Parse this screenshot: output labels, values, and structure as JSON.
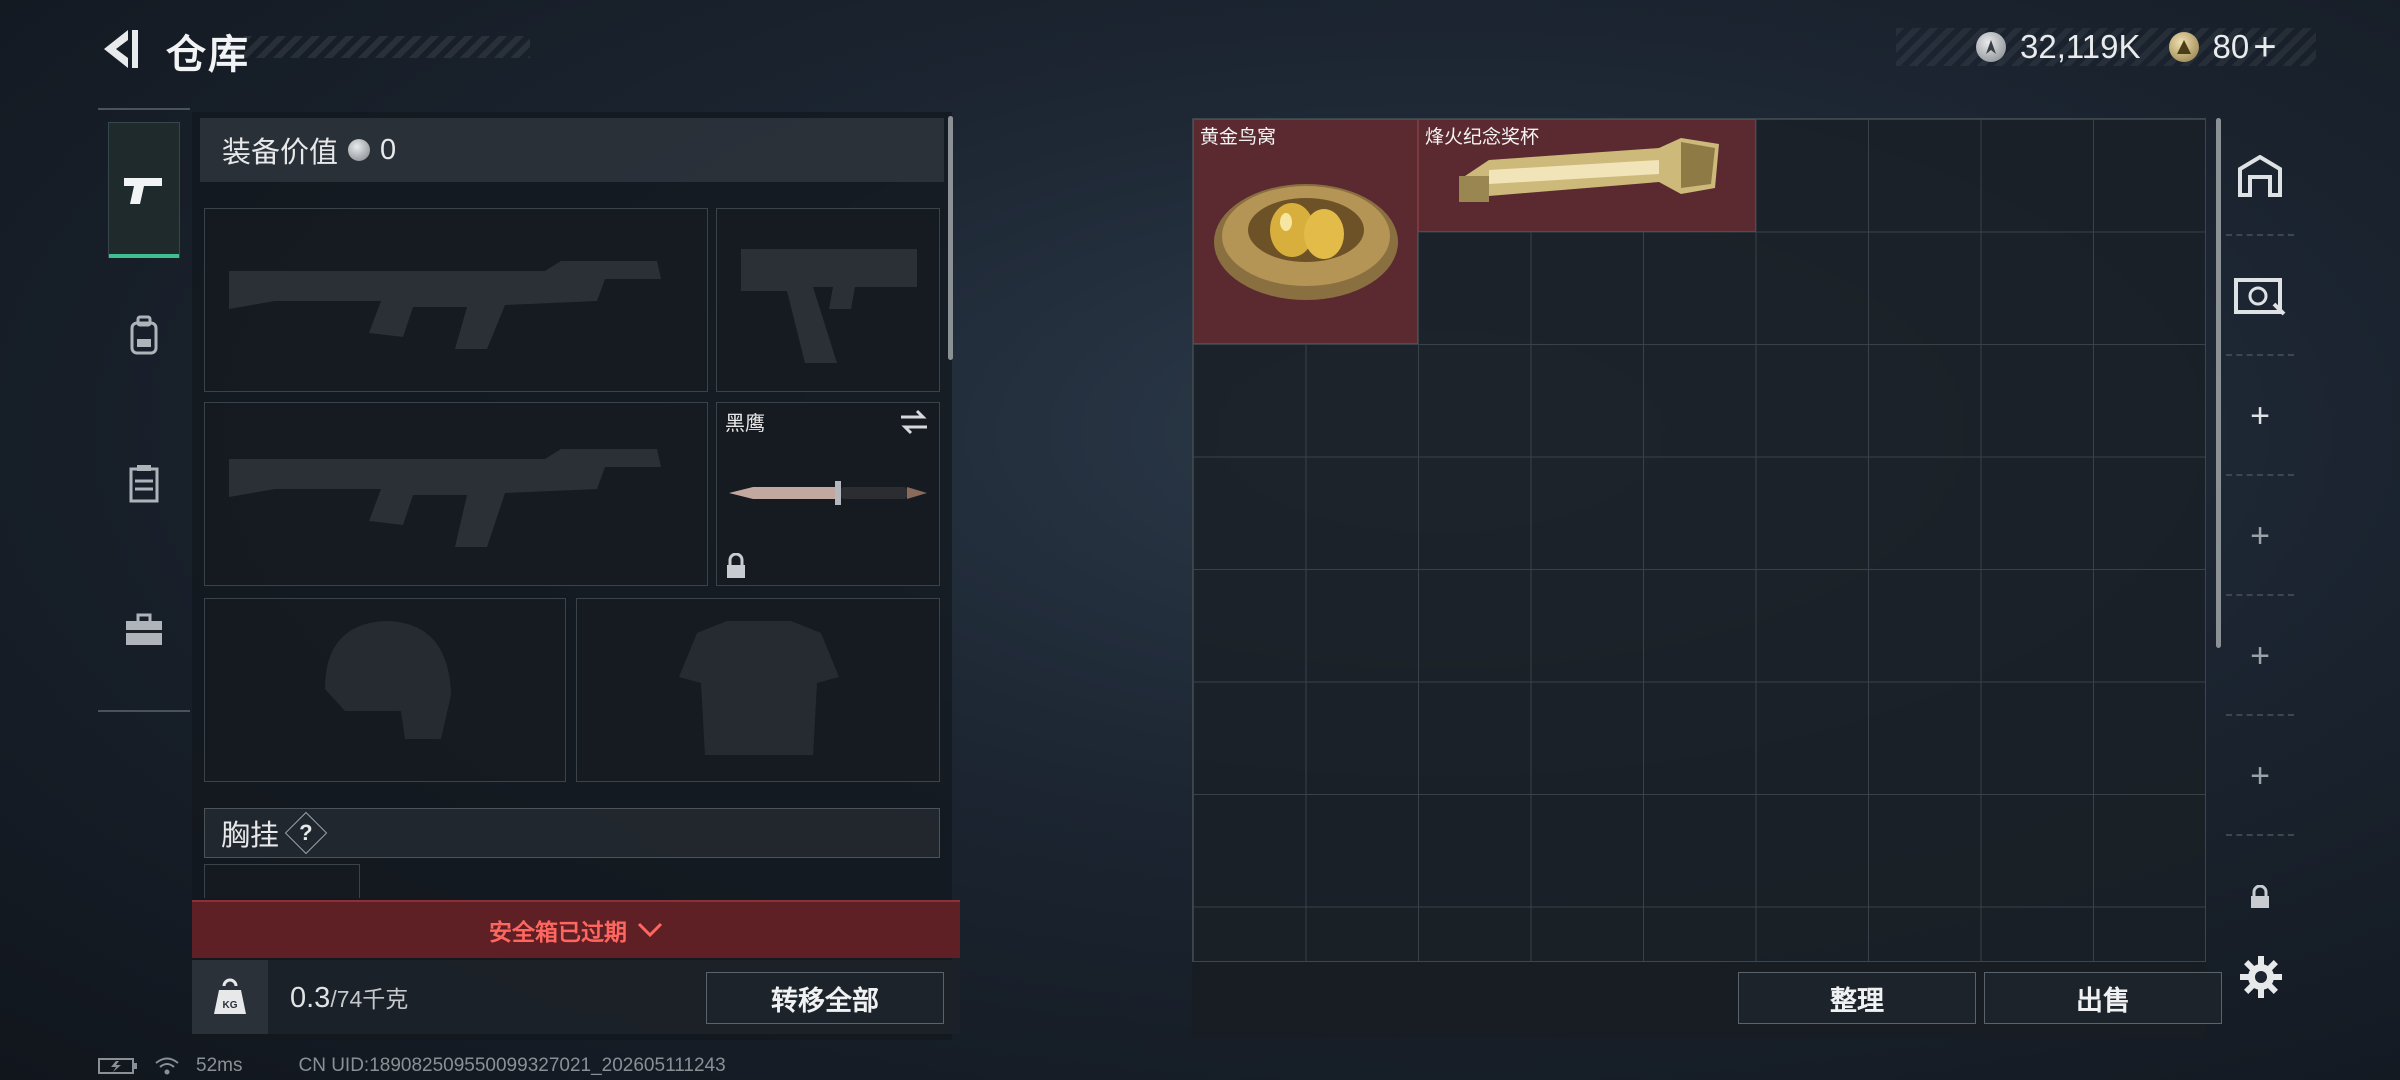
{
  "header": {
    "title": "仓库"
  },
  "currency": {
    "silver": "32,119K",
    "gold": "80",
    "gold_plus": "+"
  },
  "equipment": {
    "value_label": "装备价值",
    "value": "0",
    "knife_slot_label": "黑鹰",
    "chest_rig_label": "胸挂",
    "chest_rig_help": "?",
    "safe_box_status": "安全箱已过期",
    "weight_current": "0.3",
    "weight_max": "/74千克",
    "transfer_all_label": "转移全部"
  },
  "stash": {
    "items": [
      {
        "label": "黄金鸟窝"
      },
      {
        "label": "烽火纪念奖杯"
      }
    ],
    "sort_label": "整理",
    "sell_label": "出售"
  },
  "status_bar": {
    "ping": "52ms",
    "uid": "CN UID:1890825095500993270​21_202605111243"
  },
  "colors": {
    "accent": "#3fbf8f",
    "alert": "#ff6660",
    "item_bg": "#5b2a30"
  }
}
